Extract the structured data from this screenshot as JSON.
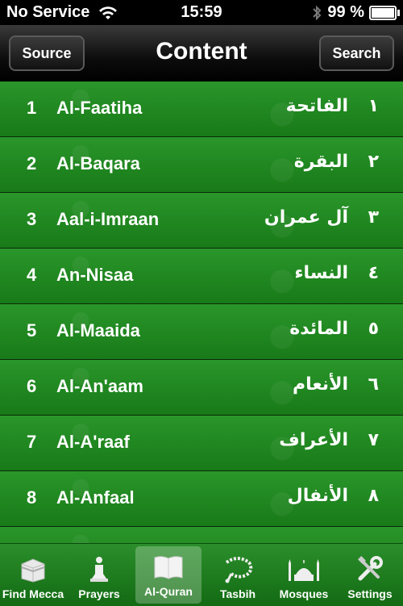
{
  "status": {
    "carrier": "No Service",
    "time": "15:59",
    "battery_text": "99 %",
    "battery_level": 0.99
  },
  "navbar": {
    "title": "Content",
    "left_button": "Source",
    "right_button": "Search"
  },
  "list": [
    {
      "num": "1",
      "name": "Al-Faatiha",
      "arabic": "الفاتحة",
      "arabic_num": "١"
    },
    {
      "num": "2",
      "name": "Al-Baqara",
      "arabic": "البقرة",
      "arabic_num": "٢"
    },
    {
      "num": "3",
      "name": "Aal-i-Imraan",
      "arabic": "آل عمران",
      "arabic_num": "٣"
    },
    {
      "num": "4",
      "name": "An-Nisaa",
      "arabic": "النساء",
      "arabic_num": "٤"
    },
    {
      "num": "5",
      "name": "Al-Maaida",
      "arabic": "المائدة",
      "arabic_num": "٥"
    },
    {
      "num": "6",
      "name": "Al-An'aam",
      "arabic": "الأنعام",
      "arabic_num": "٦"
    },
    {
      "num": "7",
      "name": "Al-A'raaf",
      "arabic": "الأعراف",
      "arabic_num": "٧"
    },
    {
      "num": "8",
      "name": "Al-Anfaal",
      "arabic": "الأنفال",
      "arabic_num": "٨"
    }
  ],
  "tabs": [
    {
      "label": "Find Mecca",
      "icon": "kaaba-icon"
    },
    {
      "label": "Prayers",
      "icon": "prayer-person-icon"
    },
    {
      "label": "Al-Quran",
      "icon": "book-icon",
      "active": true
    },
    {
      "label": "Tasbih",
      "icon": "prayer-beads-icon"
    },
    {
      "label": "Mosques",
      "icon": "mosque-icon"
    },
    {
      "label": "Settings",
      "icon": "tools-icon"
    }
  ]
}
